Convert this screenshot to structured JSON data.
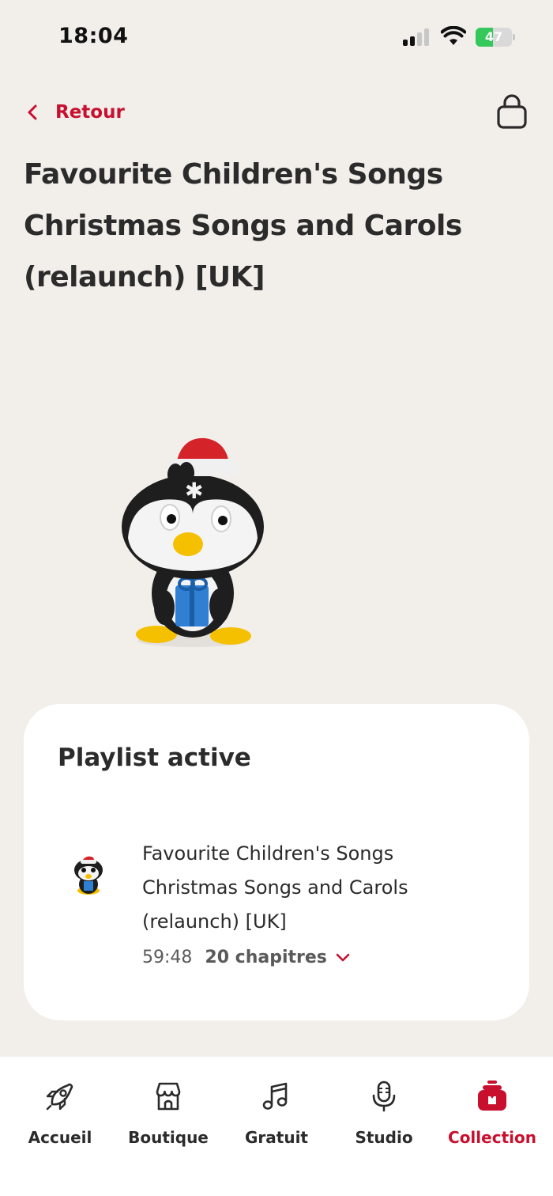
{
  "status_bar": {
    "time": "18:04",
    "battery_level": "47",
    "battery_color": "#34c759"
  },
  "nav": {
    "back_label": "Retour",
    "back_icon": "chevron-left-icon",
    "bag_icon": "shopping-bag-icon"
  },
  "product": {
    "title": "Favourite Children's Songs Christmas Songs and Carols (relaunch) [UK]"
  },
  "playlist": {
    "heading": "Playlist active",
    "track_title": "Favourite Children's Songs Christmas Songs and Carols (relaunch) [UK]",
    "duration": "59:48",
    "chapters": "20 chapitres",
    "expand_icon": "chevron-down-icon"
  },
  "tabs": [
    {
      "label": "Accueil",
      "icon": "rocket-icon",
      "active": false
    },
    {
      "label": "Boutique",
      "icon": "store-icon",
      "active": false
    },
    {
      "label": "Gratuit",
      "icon": "music-note-icon",
      "active": false
    },
    {
      "label": "Studio",
      "icon": "microphone-icon",
      "active": false
    },
    {
      "label": "Collection",
      "icon": "collection-icon",
      "active": true
    }
  ],
  "colors": {
    "accent": "#c8102e",
    "background": "#f2efeb",
    "card": "#ffffff"
  }
}
